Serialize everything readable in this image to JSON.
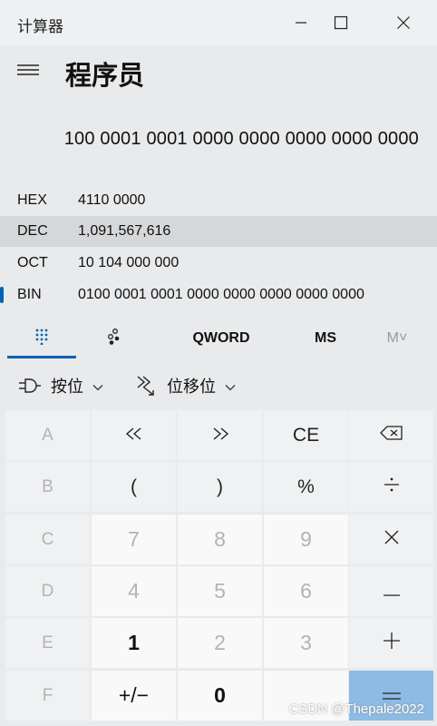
{
  "window": {
    "title": "计算器",
    "minimize_icon": "minimize-icon",
    "maximize_icon": "maximize-icon",
    "close_icon": "close-icon"
  },
  "header": {
    "menu_icon": "hamburger-menu-icon",
    "mode": "程序员"
  },
  "display": {
    "value": "100 0001 0001 0000 0000 0000 0000 0000"
  },
  "radix": [
    {
      "name": "HEX",
      "value": "4110 0000",
      "selected": false
    },
    {
      "name": "DEC",
      "value": "1,091,567,616",
      "selected": true
    },
    {
      "name": "OCT",
      "value": "10 104 000 000",
      "selected": false
    },
    {
      "name": "BIN",
      "value": "0100 0001 0001 0000 0000 0000 0000 0000",
      "selected": false,
      "active_indicator": true
    }
  ],
  "tabs": {
    "keypad_icon": "full-keypad-icon",
    "bit_toggle_icon": "bit-toggle-keypad-icon",
    "word_size": "QWORD",
    "memory_store": "MS",
    "memory_menu": "M˅"
  },
  "tools": {
    "bitwise_label": "按位",
    "bitshift_label": "位移位"
  },
  "keys": {
    "A": "A",
    "lsh": "«",
    "rsh": "»",
    "CE": "CE",
    "B": "B",
    "lparen": "(",
    "rparen": ")",
    "percent": "%",
    "C": "C",
    "n7": "7",
    "n8": "8",
    "n9": "9",
    "D": "D",
    "n4": "4",
    "n5": "5",
    "n6": "6",
    "E": "E",
    "n1": "1",
    "n2": "2",
    "n3": "3",
    "F": "F",
    "negate": "+/−",
    "n0": "0",
    "decimal": "",
    "equals": "="
  },
  "watermark": "CSDN @Thepale2022",
  "colors": {
    "accent": "#0063b1",
    "equals_key": "#8dbbe4",
    "background": "#e9eaec"
  }
}
